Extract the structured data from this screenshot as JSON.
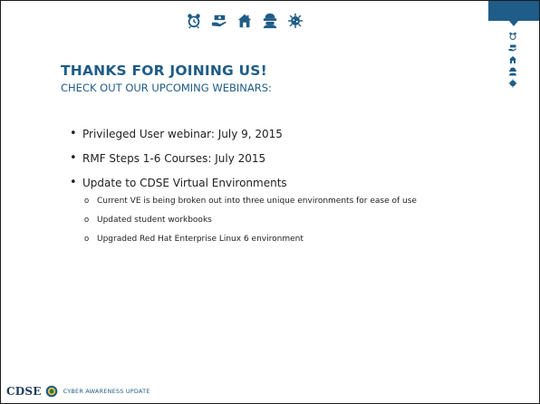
{
  "header": {
    "icons": [
      "alarm-clock-icon",
      "money-hand-icon",
      "home-icon",
      "hacker-icon",
      "virus-icon"
    ],
    "side_icons": [
      "alarm-clock-icon",
      "money-hand-icon",
      "home-icon",
      "hacker-icon",
      "virus-icon"
    ],
    "accent_color": "#1f5c87"
  },
  "content": {
    "title": "THANKS FOR JOINING US!",
    "subtitle": "CHECK OUT OUR UPCOMING WEBINARS:",
    "bullets": [
      {
        "text": "Privileged User webinar: July 9,   2015"
      },
      {
        "text": "RMF Steps 1-6 Courses:  July 2015"
      },
      {
        "text": "Update to CDSE Virtual Environments",
        "sub": [
          "Current VE is being broken out into three unique environments for ease of use",
          "Updated student workbooks",
          "Upgraded Red Hat Enterprise Linux 6 environment"
        ]
      }
    ]
  },
  "footer": {
    "logo_text": "CDSE",
    "label": "CYBER AWARENESS UPDATE"
  }
}
